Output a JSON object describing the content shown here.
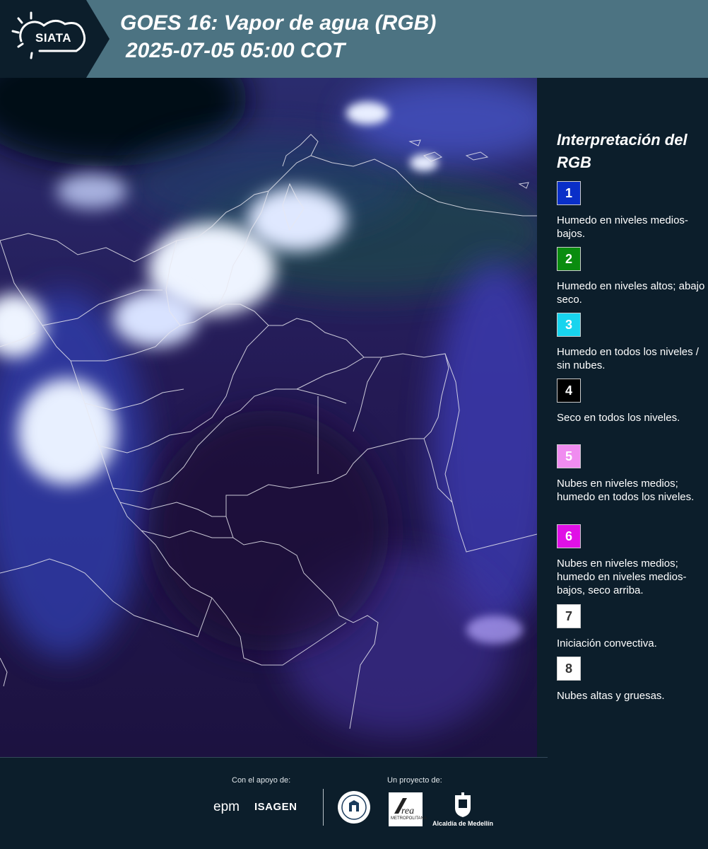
{
  "header": {
    "logo_text": "SIATA",
    "title_line1": "GOES 16: Vapor de agua (RGB)",
    "title_line2": "2025-07-05 05:00 COT"
  },
  "legend": {
    "title": "Interpretación del RGB",
    "items": [
      {
        "number": "1",
        "color": "#0a2fc8",
        "text_color": "#ffffff",
        "description": "Humedo en niveles medios-bajos."
      },
      {
        "number": "2",
        "color": "#0a8c0f",
        "text_color": "#ffffff",
        "description": "Humedo en niveles altos; abajo seco."
      },
      {
        "number": "3",
        "color": "#18d4ee",
        "text_color": "#ffffff",
        "description": "Humedo en todos los niveles / sin nubes."
      },
      {
        "number": "4",
        "color": "#000000",
        "text_color": "#ffffff",
        "description": "Seco en todos los niveles."
      },
      {
        "number": "5",
        "color": "#f08cf0",
        "text_color": "#ffffff",
        "description": "Nubes en niveles medios; humedo en todos los niveles."
      },
      {
        "number": "6",
        "color": "#e010e6",
        "text_color": "#ffffff",
        "description": "Nubes en niveles medios; humedo en niveles medios-bajos, seco arriba."
      },
      {
        "number": "7",
        "color": "#ffffff",
        "text_color": "#333333",
        "description": "Iniciación convectiva."
      },
      {
        "number": "8",
        "color": "#ffffff",
        "text_color": "#333333",
        "description": "Nubes altas y gruesas."
      }
    ]
  },
  "footer": {
    "support_label": "Con el apoyo de:",
    "project_label": "Un proyecto de:",
    "epm_text": "epm",
    "isagen_text": "ISAGEN",
    "area_text": "METROPOLITANA",
    "alcaldia_text": "Alcaldía de Medellín"
  }
}
